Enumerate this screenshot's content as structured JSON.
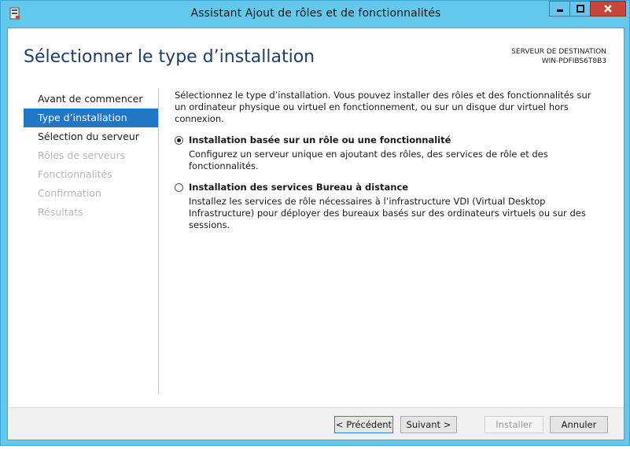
{
  "window": {
    "title": "Assistant Ajout de rôles et de fonctionnalités"
  },
  "header": {
    "page_title": "Sélectionner le type d’installation",
    "destination_label": "SERVEUR DE DESTINATION",
    "destination_value": "WIN-PDFIBS6T8B3"
  },
  "nav": {
    "items": [
      {
        "label": "Avant de commencer",
        "state": "normal"
      },
      {
        "label": "Type d’installation",
        "state": "active"
      },
      {
        "label": "Sélection du serveur",
        "state": "normal"
      },
      {
        "label": "Rôles de serveurs",
        "state": "disabled"
      },
      {
        "label": "Fonctionnalités",
        "state": "disabled"
      },
      {
        "label": "Confirmation",
        "state": "disabled"
      },
      {
        "label": "Résultats",
        "state": "disabled"
      }
    ]
  },
  "content": {
    "intro": "Sélectionnez le type d’installation. Vous pouvez installer des rôles et des fonctionnalités sur un ordinateur physique ou virtuel en fonctionnement, ou sur un disque dur virtuel hors connexion.",
    "options": [
      {
        "label": "Installation basée sur un rôle ou une fonctionnalité",
        "description": "Configurez un serveur unique en ajoutant des rôles, des services de rôle et des fonctionnalités.",
        "checked": true
      },
      {
        "label": "Installation des services Bureau à distance",
        "description": "Installez les services de rôle nécessaires à l’infrastructure VDI (Virtual Desktop Infrastructure) pour déployer des bureaux basés sur des ordinateurs virtuels ou sur des sessions.",
        "checked": false
      }
    ]
  },
  "footer": {
    "prev": "< Précédent",
    "next": "Suivant >",
    "install": "Installer",
    "cancel": "Annuler"
  },
  "colors": {
    "frame": "#63c8eb",
    "title_text": "#1e3e6c",
    "nav_active": "#1f77c6",
    "close_button": "#c7453a"
  },
  "icons": [
    "server-manager-icon",
    "minimize-icon",
    "maximize-icon",
    "close-icon"
  ]
}
